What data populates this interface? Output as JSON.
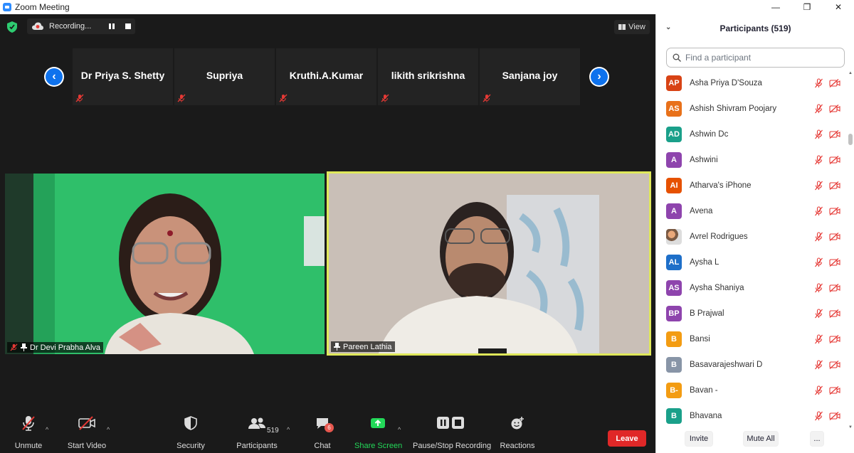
{
  "window": {
    "title": "Zoom Meeting",
    "minimize": "—",
    "restore": "❐",
    "close": "✕"
  },
  "top": {
    "recording_label": "Recording...",
    "view_label": "View"
  },
  "strip": {
    "tiles": [
      {
        "name": "Dr Priya S. Shetty"
      },
      {
        "name": "Supriya"
      },
      {
        "name": "Kruthi.A.Kumar"
      },
      {
        "name": "likith srikrishna"
      },
      {
        "name": "Sanjana joy"
      }
    ],
    "prev_icon": "‹",
    "next_icon": "›"
  },
  "videos": [
    {
      "name": "Dr Devi Prabha Alva",
      "muted": true,
      "pinned": true
    },
    {
      "name": "Pareen Lathia",
      "muted": false,
      "pinned": true,
      "active_speaker": true
    }
  ],
  "toolbar": {
    "unmute": "Unmute",
    "start_video": "Start Video",
    "security": "Security",
    "participants": "Participants",
    "participants_count": "519",
    "chat": "Chat",
    "chat_badge": "6",
    "share_screen": "Share Screen",
    "recording": "Pause/Stop Recording",
    "reactions": "Reactions",
    "leave": "Leave"
  },
  "panel": {
    "title": "Participants (519)",
    "search_placeholder": "Find a participant",
    "participants": [
      {
        "initials": "AP",
        "name": "Asha Priya D'Souza",
        "color": "#d84315"
      },
      {
        "initials": "AS",
        "name": "Ashish Shivram Poojary",
        "color": "#e8711a"
      },
      {
        "initials": "AD",
        "name": "Ashwin Dc",
        "color": "#1aa08a"
      },
      {
        "initials": "A",
        "name": "Ashwini",
        "color": "#8e44ad"
      },
      {
        "initials": "AI",
        "name": "Atharva's iPhone",
        "color": "#e65100"
      },
      {
        "initials": "A",
        "name": "Avena",
        "color": "#8e44ad"
      },
      {
        "initials": "",
        "name": "Avrel Rodrigues",
        "color": "#cccccc",
        "photo": true
      },
      {
        "initials": "AL",
        "name": "Aysha L",
        "color": "#1e6fc9"
      },
      {
        "initials": "AS",
        "name": "Aysha Shaniya",
        "color": "#8e44ad"
      },
      {
        "initials": "BP",
        "name": "B Prajwal",
        "color": "#8e44ad"
      },
      {
        "initials": "B",
        "name": "Bansi",
        "color": "#f39c12"
      },
      {
        "initials": "B",
        "name": "Basavarajeshwari D",
        "color": "#8895a7"
      },
      {
        "initials": "B-",
        "name": "Bavan -",
        "color": "#f39c12"
      },
      {
        "initials": "B",
        "name": "Bhavana",
        "color": "#1aa08a"
      }
    ],
    "invite": "Invite",
    "mute_all": "Mute All",
    "more": "..."
  }
}
